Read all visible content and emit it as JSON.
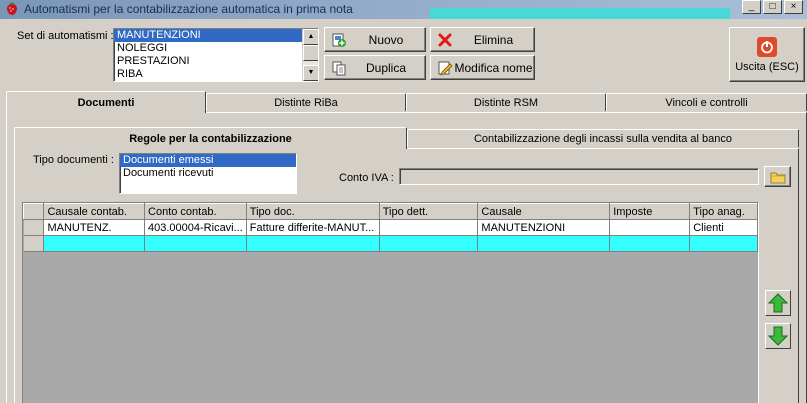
{
  "window": {
    "title": "Automatismi per la contabilizzazione automatica in prima nota"
  },
  "set_label": "Set di automatismi :",
  "set_list": [
    "MANUTENZIONI",
    "NOLEGGI",
    "PRESTAZIONI",
    "RIBA"
  ],
  "buttons": {
    "nuovo": "Nuovo",
    "elimina": "Elimina",
    "duplica": "Duplica",
    "modifica_nome": "Modifica nome",
    "uscita": "Uscita (ESC)"
  },
  "main_tabs": [
    "Documenti",
    "Distinte RiBa",
    "Distinte RSM",
    "Vincoli e controlli"
  ],
  "sub_tabs": [
    "Regole per la contabilizzazione",
    "Contabilizzazione degli incassi sulla vendita al banco"
  ],
  "tipo_documenti_label": "Tipo documenti :",
  "tipo_documenti": [
    "Documenti emessi",
    "Documenti ricevuti"
  ],
  "conto_iva_label": "Conto IVA :",
  "conto_iva_value": "",
  "grid": {
    "columns": [
      "Causale contab.",
      "Conto contab.",
      "Tipo doc.",
      "Tipo dett.",
      "Causale",
      "Imposte",
      "Tipo anag."
    ],
    "rows": [
      [
        "MANUTENZ.",
        "403.00004-Ricavi...",
        "Fatture differite-MANUT...",
        "",
        "MANUTENZIONI",
        "",
        "Clienti"
      ],
      [
        "",
        "",
        "",
        "",
        "",
        "",
        ""
      ]
    ]
  },
  "colors": {
    "selection": "#316ac5",
    "current_row": "#33ffff",
    "grid_empty": "#a9a9a9"
  },
  "icons": {
    "app": "strawberry-icon",
    "nuovo": "add-page-icon",
    "elimina": "red-x-icon",
    "duplica": "copy-icon",
    "modifica_nome": "edit-icon",
    "uscita": "power-icon",
    "folder": "folder-icon",
    "up": "green-up-arrow-icon",
    "down": "green-down-arrow-icon"
  }
}
